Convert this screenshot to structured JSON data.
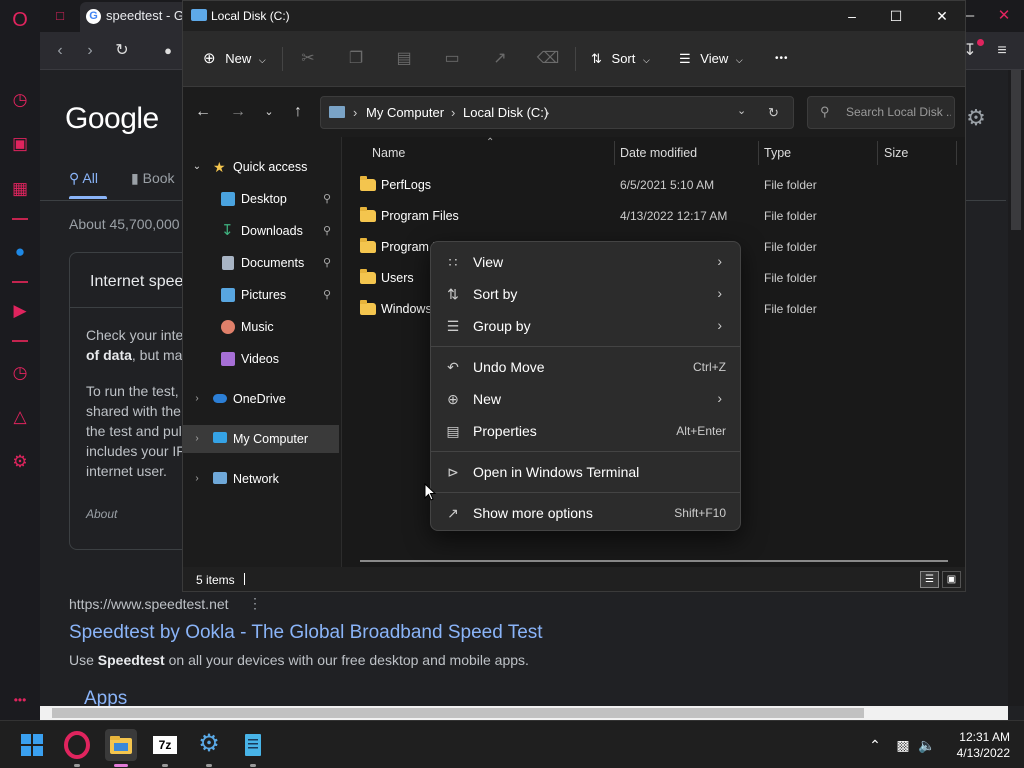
{
  "browser": {
    "tab_title": "speedtest - Go",
    "accent": "#e0245e"
  },
  "google": {
    "logo": "Google",
    "tab_all": "All",
    "tab_books": "Book",
    "about_results": "About 45,700,000",
    "card": {
      "title": "Internet spee",
      "lines": [
        {
          "pre": "Check your inte",
          "bold": ""
        },
        {
          "pre": "",
          "bold": "of data",
          "post": ", but ma"
        },
        {
          "pre": "To run the test,",
          "bold": ""
        },
        {
          "pre": "shared with the",
          "bold": ""
        },
        {
          "pre": "the test and pul",
          "bold": ""
        },
        {
          "pre": "includes your IF",
          "bold": ""
        },
        {
          "pre": "internet user.",
          "bold": ""
        }
      ],
      "about": "About"
    },
    "result": {
      "url": "https://www.speedtest.net",
      "title": "Speedtest by Ookla - The Global Broadband Speed Test",
      "snippet_pre": "Use ",
      "snippet_bold": "Speedtest",
      "snippet_post": " on all your devices with our free desktop and mobile apps."
    },
    "apps_heading": "Apps"
  },
  "explorer": {
    "title": "Local Disk (C:)",
    "toolbar": {
      "new_label": "New",
      "sort_label": "Sort",
      "view_label": "View",
      "more_label": "•••"
    },
    "breadcrumb": [
      "My Computer",
      "Local Disk (C:)"
    ],
    "search_placeholder": "Search Local Disk ...",
    "nav": {
      "quick_access": "Quick access",
      "items": [
        {
          "label": "Desktop",
          "color": "#4aa3df",
          "pinned": true
        },
        {
          "label": "Downloads",
          "color": "#3fb27f",
          "pinned": true
        },
        {
          "label": "Documents",
          "color": "#a8b4c4",
          "pinned": true
        },
        {
          "label": "Pictures",
          "color": "#58a6e0",
          "pinned": true
        },
        {
          "label": "Music",
          "color": "#e0806a",
          "pinned": false
        },
        {
          "label": "Videos",
          "color": "#a66fd6",
          "pinned": false
        }
      ],
      "onedrive": "OneDrive",
      "my_computer": "My Computer",
      "network": "Network"
    },
    "columns": {
      "name": "Name",
      "date": "Date modified",
      "type": "Type",
      "size": "Size"
    },
    "rows": [
      {
        "name": "PerfLogs",
        "date": "6/5/2021 5:10 AM",
        "type": "File folder"
      },
      {
        "name": "Program Files",
        "date": "4/13/2022 12:17 AM",
        "type": "File folder"
      },
      {
        "name": "Program F",
        "date": "",
        "type": "File folder"
      },
      {
        "name": "Users",
        "date": "",
        "type": "File folder"
      },
      {
        "name": "Windows",
        "date": "",
        "type": "File folder"
      }
    ],
    "status": "5 items"
  },
  "context_menu": {
    "items": [
      {
        "label": "View",
        "icon": "grid-icon",
        "submenu": true,
        "shortcut": ""
      },
      {
        "label": "Sort by",
        "icon": "sort-icon",
        "submenu": true,
        "shortcut": ""
      },
      {
        "label": "Group by",
        "icon": "list-icon",
        "submenu": true,
        "shortcut": ""
      },
      {
        "label": "Undo Move",
        "icon": "undo-icon",
        "submenu": false,
        "shortcut": "Ctrl+Z"
      },
      {
        "label": "New",
        "icon": "plus-circle-icon",
        "submenu": true,
        "shortcut": ""
      },
      {
        "label": "Properties",
        "icon": "properties-icon",
        "submenu": false,
        "shortcut": "Alt+Enter"
      },
      {
        "label": "Open in Windows Terminal",
        "icon": "terminal-icon",
        "submenu": false,
        "shortcut": ""
      },
      {
        "label": "Show more options",
        "icon": "show-more-icon",
        "submenu": false,
        "shortcut": "Shift+F10"
      }
    ]
  },
  "taskbar": {
    "sevenzip_label": "7z",
    "time": "12:31 AM",
    "date": "4/13/2022"
  }
}
